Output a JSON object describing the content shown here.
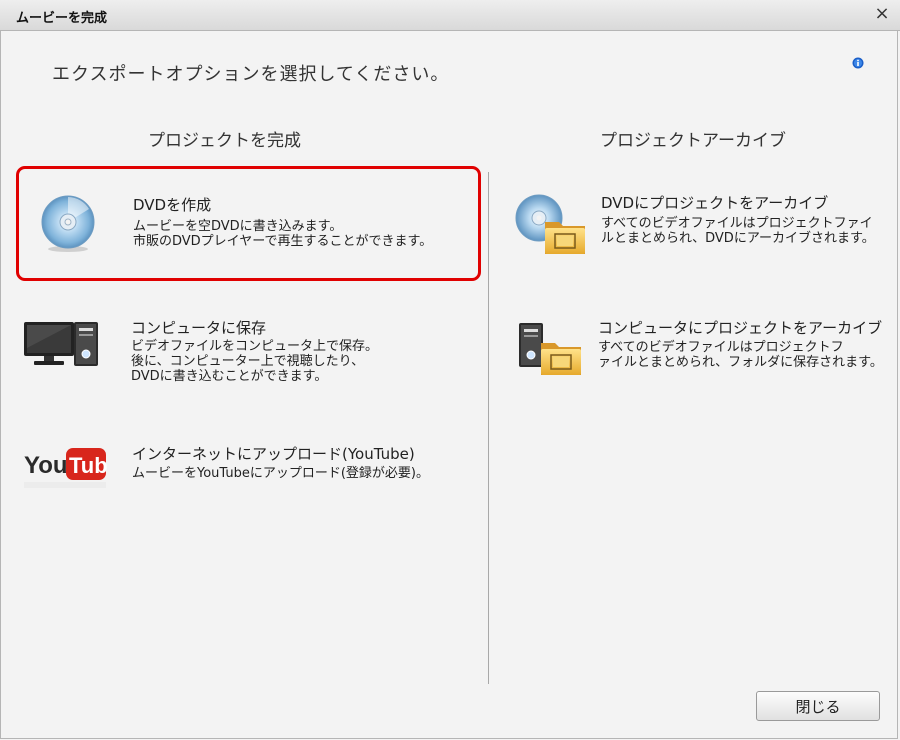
{
  "window": {
    "title": "ムービーを完成",
    "close_icon": "×"
  },
  "instruction": "エクスポートオプションを選択してください。",
  "info_icon": "info-icon",
  "left_column": {
    "heading": "プロジェクトを完成",
    "options": [
      {
        "name": "DVDを作成",
        "desc": "ムービーを空DVDに書き込みます。\n市販のDVDプレイヤーで再生することができます。",
        "icon": "disc-icon",
        "selected": true
      },
      {
        "name": "コンピュータに保存",
        "desc": "ビデオファイルをコンピュータ上で保存。\n後に、コンピューター上で視聴したり、\nDVDに書き込むことができます。",
        "icon": "computer-icon"
      },
      {
        "name": "インターネットにアップロード(YouTube)",
        "desc": "ムービーをYouTubeにアップロード(登録が必要)。",
        "icon": "youtube-icon",
        "logo_text": "YouTube"
      }
    ]
  },
  "right_column": {
    "heading": "プロジェクトアーカイブ",
    "options": [
      {
        "name": "DVDにプロジェクトをアーカイブ",
        "desc": "すべてのビデオファイルはプロジェクトファイ\nルとまとめられ、DVDにアーカイブされます。",
        "icon": "disc-folder-icon"
      },
      {
        "name": "コンピュータにプロジェクトをアーカイブ",
        "desc": "すべてのビデオファイルはプロジェクトフ\nァイルとまとめられ、フォルダに保存されます。",
        "icon": "computer-folder-icon"
      }
    ]
  },
  "footer": {
    "close_label": "閉じる"
  },
  "colors": {
    "selection_border": "#e00000",
    "youtube_red": "#d8261c",
    "background": "#f3f3f3"
  }
}
